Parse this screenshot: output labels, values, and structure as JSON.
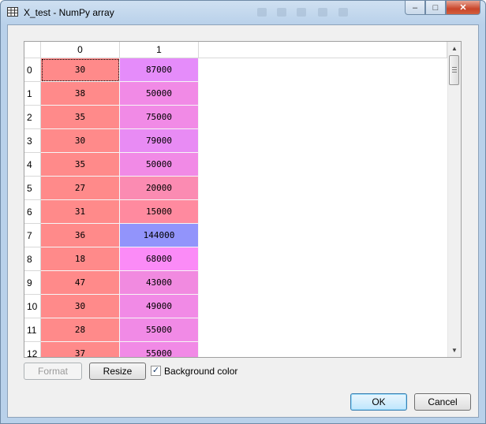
{
  "window": {
    "title": "X_test - NumPy array",
    "controls": {
      "minimize": "–",
      "maximize": "□",
      "close": "✕"
    }
  },
  "table": {
    "columns": [
      "0",
      "1"
    ],
    "rows": [
      {
        "index": "0",
        "c0": "30",
        "c1": "87000",
        "bg0": "#ff8a8a",
        "bg1": "#e58cfa"
      },
      {
        "index": "1",
        "c0": "38",
        "c1": "50000",
        "bg0": "#ff8a8a",
        "bg1": "#f18ae6"
      },
      {
        "index": "2",
        "c0": "35",
        "c1": "75000",
        "bg0": "#ff8a8a",
        "bg1": "#f18ae6"
      },
      {
        "index": "3",
        "c0": "30",
        "c1": "79000",
        "bg0": "#ff8a8a",
        "bg1": "#e88bf4"
      },
      {
        "index": "4",
        "c0": "35",
        "c1": "50000",
        "bg0": "#ff8a8a",
        "bg1": "#f18ae6"
      },
      {
        "index": "5",
        "c0": "27",
        "c1": "20000",
        "bg0": "#ff8a8a",
        "bg1": "#fb8bb2"
      },
      {
        "index": "6",
        "c0": "31",
        "c1": "15000",
        "bg0": "#ff8a8a",
        "bg1": "#ff8a9f"
      },
      {
        "index": "7",
        "c0": "36",
        "c1": "144000",
        "bg0": "#ff8a8a",
        "bg1": "#9294fb"
      },
      {
        "index": "8",
        "c0": "18",
        "c1": "68000",
        "bg0": "#ff8a8a",
        "bg1": "#fb8bf7"
      },
      {
        "index": "9",
        "c0": "47",
        "c1": "43000",
        "bg0": "#ff8a8a",
        "bg1": "#f18ae0"
      },
      {
        "index": "10",
        "c0": "30",
        "c1": "49000",
        "bg0": "#ff8a8a",
        "bg1": "#f18ae6"
      },
      {
        "index": "11",
        "c0": "28",
        "c1": "55000",
        "bg0": "#ff8a8a",
        "bg1": "#f18ae6"
      },
      {
        "index": "12",
        "c0": "37",
        "c1": "55000",
        "bg0": "#ff8a8a",
        "bg1": "#f18ae6"
      }
    ]
  },
  "buttons": {
    "format": "Format",
    "resize": "Resize",
    "ok": "OK",
    "cancel": "Cancel"
  },
  "background_color": {
    "label": "Background color",
    "checked": true,
    "mark": "✓"
  }
}
